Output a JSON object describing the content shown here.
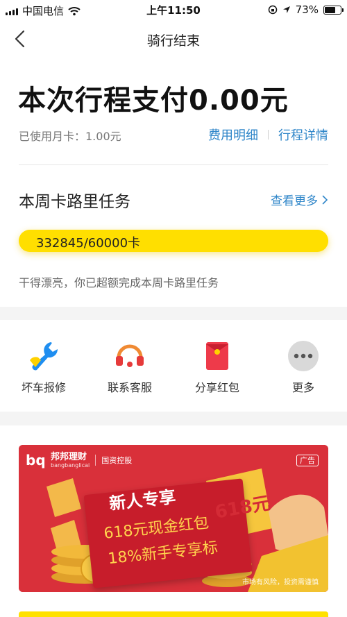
{
  "status_bar": {
    "carrier": "中国电信",
    "time": "上午11:50",
    "battery_text": "73%",
    "battery_level": 0.73
  },
  "nav": {
    "title": "骑行结束"
  },
  "payment": {
    "title": "本次行程支付0.00元",
    "month_card": "已使用月卡：1.00元",
    "fee_detail_link": "费用明细",
    "trip_detail_link": "行程详情"
  },
  "weekly_task": {
    "title": "本周卡路里任务",
    "more_link": "查看更多",
    "progress_text": "332845/60000卡",
    "progress": 1.0,
    "message": "干得漂亮，你已超额完成本周卡路里任务"
  },
  "services": [
    {
      "label": "坏车报修",
      "icon": "wrench-icon"
    },
    {
      "label": "联系客服",
      "icon": "headset-icon"
    },
    {
      "label": "分享红包",
      "icon": "red-envelope-icon"
    },
    {
      "label": "更多",
      "icon": "more-dots-icon"
    }
  ],
  "ad": {
    "brand_mark": "bq",
    "brand_name": "邦邦理财",
    "brand_pinyin": "bangbanglicai",
    "brand_state": "国资控股",
    "tag": "广告",
    "headline": "新人专享",
    "line2": "618元现金红包",
    "line3": "18%新手专享标",
    "badge": "618元",
    "risk": "市场有风险，投资需谨慎",
    "colors": {
      "background": "#d9303a",
      "accent": "#ffd34d"
    }
  },
  "colors": {
    "link": "#2f86c9",
    "progress": "#ffdf00"
  }
}
